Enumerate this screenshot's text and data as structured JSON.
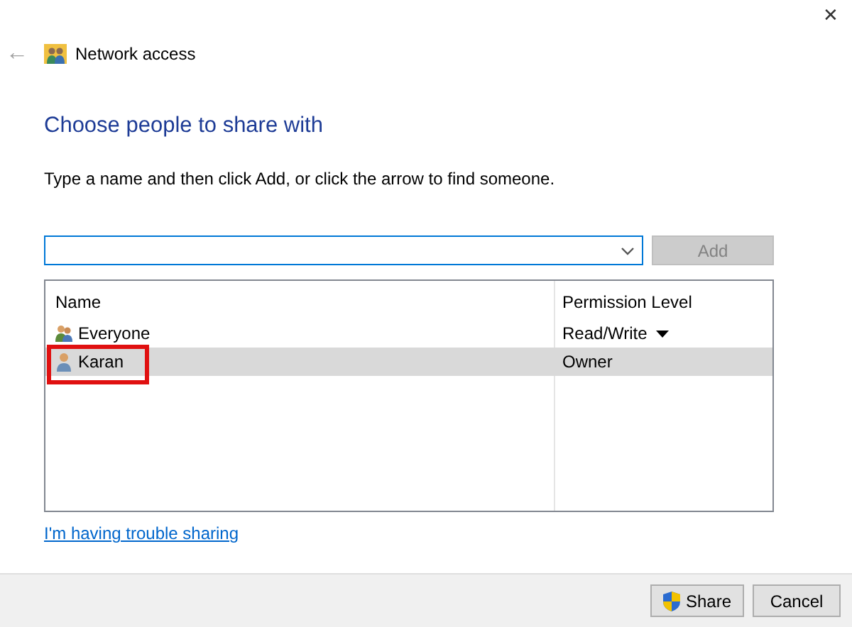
{
  "window": {
    "title": "Network access",
    "close": "✕",
    "back": "←"
  },
  "heading": "Choose people to share with",
  "instruction": "Type a name and then click Add, or click the arrow to find someone.",
  "name_field": {
    "focused": true
  },
  "add_button": {
    "label": "Add",
    "disabled": true
  },
  "table": {
    "columns": [
      "Name",
      "Permission Level"
    ],
    "rows": [
      {
        "name": "Everyone",
        "kind": "group",
        "permission": "Read/Write",
        "has_dropdown": true,
        "selected": false,
        "annotated": false
      },
      {
        "name": "Karan",
        "kind": "user",
        "permission": "Owner",
        "has_dropdown": false,
        "selected": true,
        "annotated": true
      }
    ]
  },
  "help_link": "I'm having trouble sharing",
  "buttons": [
    {
      "label": "Share",
      "kind": "shield"
    },
    {
      "label": "Cancel",
      "kind": "plain"
    }
  ]
}
